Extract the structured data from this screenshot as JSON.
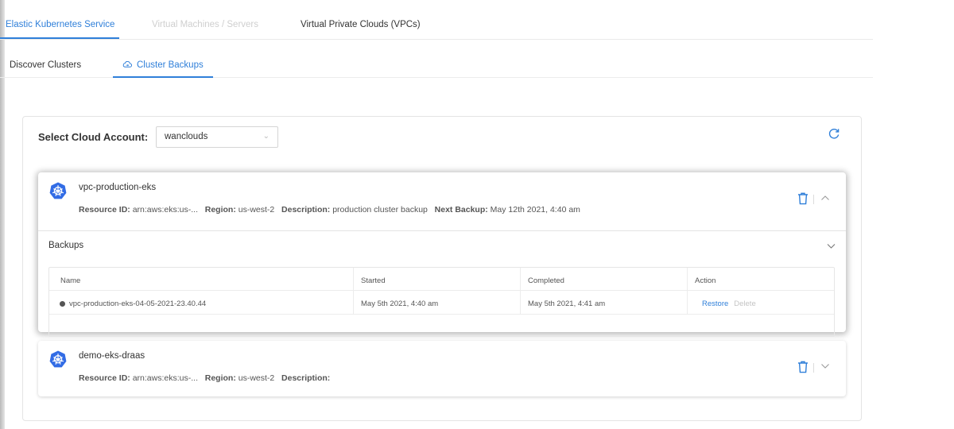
{
  "top_tabs": [
    {
      "label": "Elastic Kubernetes Service"
    },
    {
      "label": "Virtual Machines / Servers"
    },
    {
      "label": "Virtual Private Clouds (VPCs)"
    }
  ],
  "sub_tabs": [
    {
      "label": "Discover Clusters"
    },
    {
      "label": "Cluster Backups"
    }
  ],
  "account": {
    "label": "Select Cloud Account:",
    "selected": "wanclouds"
  },
  "clusters": [
    {
      "name": "vpc-production-eks",
      "resource_label": "Resource ID:",
      "resource_value": "arn:aws:eks:us-...",
      "region_label": "Region:",
      "region_value": "us-west-2",
      "description_label": "Description:",
      "description_value": "production cluster backup",
      "next_backup_label": "Next Backup:",
      "next_backup_value": "May 12th 2021, 4:40 am",
      "backups": {
        "title": "Backups",
        "columns": [
          "Name",
          "Started",
          "Completed",
          "Action"
        ],
        "rows": [
          {
            "name": "vpc-production-eks-04-05-2021-23.40.44",
            "started": "May 5th 2021, 4:40 am",
            "completed": "May 5th 2021, 4:41 am",
            "restore": "Restore",
            "delete": "Delete"
          }
        ]
      }
    },
    {
      "name": "demo-eks-draas",
      "resource_label": "Resource ID:",
      "resource_value": "arn:aws:eks:us-...",
      "region_label": "Region:",
      "region_value": "us-west-2",
      "description_label": "Description:",
      "description_value": ""
    }
  ],
  "colors": {
    "accent": "#2f7fd9",
    "kubernetes": "#326ce5",
    "muted": "#c4c4c4"
  },
  "icons": [
    "cloud-sync-icon",
    "refresh-icon",
    "kubernetes-icon",
    "trash-icon",
    "chevron-up-icon",
    "chevron-down-icon",
    "status-dot-icon"
  ]
}
